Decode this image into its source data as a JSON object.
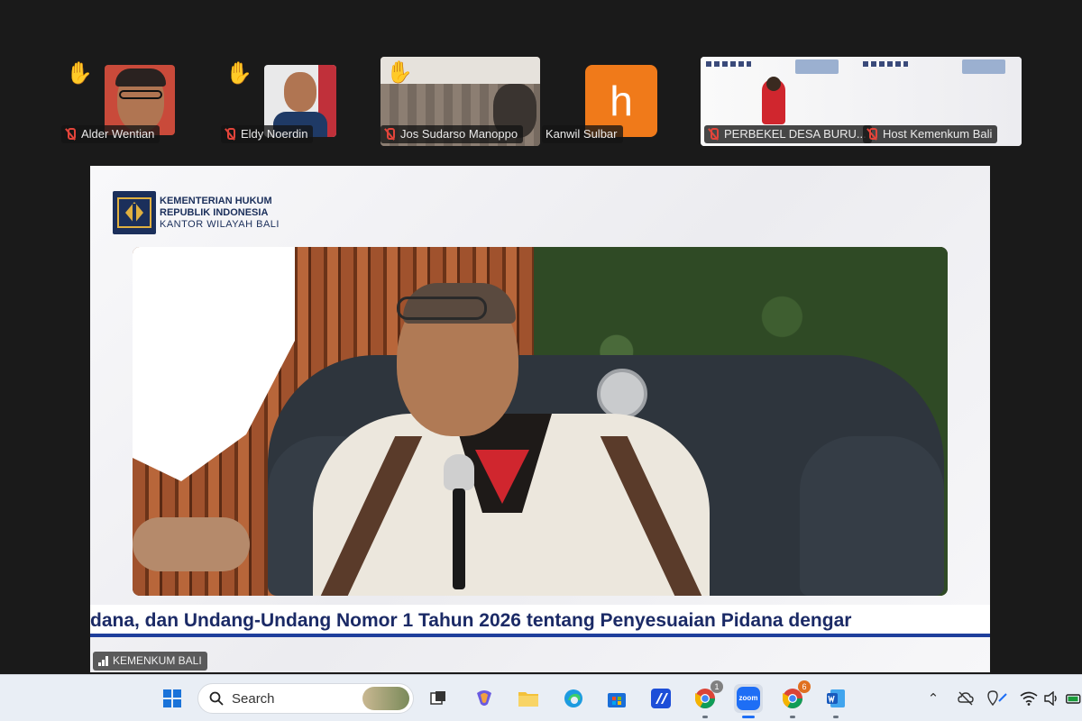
{
  "participants": [
    {
      "name": "Alder Wentian",
      "hand_raised": true,
      "muted": true
    },
    {
      "name": "Eldy Noerdin",
      "hand_raised": true,
      "muted": true
    },
    {
      "name": "Jos Sudarso Manoppo",
      "hand_raised": true,
      "muted": true
    },
    {
      "name": "Kanwil Sulbar",
      "avatar_letter": "h",
      "avatar_color": "#f07a1a",
      "muted": false
    },
    {
      "name": "PERBEKEL DESA BURU...",
      "muted": true
    },
    {
      "name": "Host Kemenkum Bali",
      "muted": true
    }
  ],
  "shared_screen": {
    "org_line1": "KEMENTERIAN HUKUM",
    "org_line2": "REPUBLIK INDONESIA",
    "org_line3": "KANTOR WILAYAH BALI",
    "ticker": "dana, dan Undang-Undang Nomor 1 Tahun 2026 tentang Penyesuaian Pidana dengar",
    "channel_label": "KEMENKUM BALI"
  },
  "taskbar": {
    "search_label": "Search",
    "chrome_badge_1": "1",
    "chrome_badge_2": "6",
    "zoom_label": "zoom"
  },
  "colors": {
    "ticker_text": "#1b2a66",
    "ticker_border": "#1f3f9c",
    "mute_red": "#e2443a",
    "avatar_orange": "#f07a1a"
  }
}
